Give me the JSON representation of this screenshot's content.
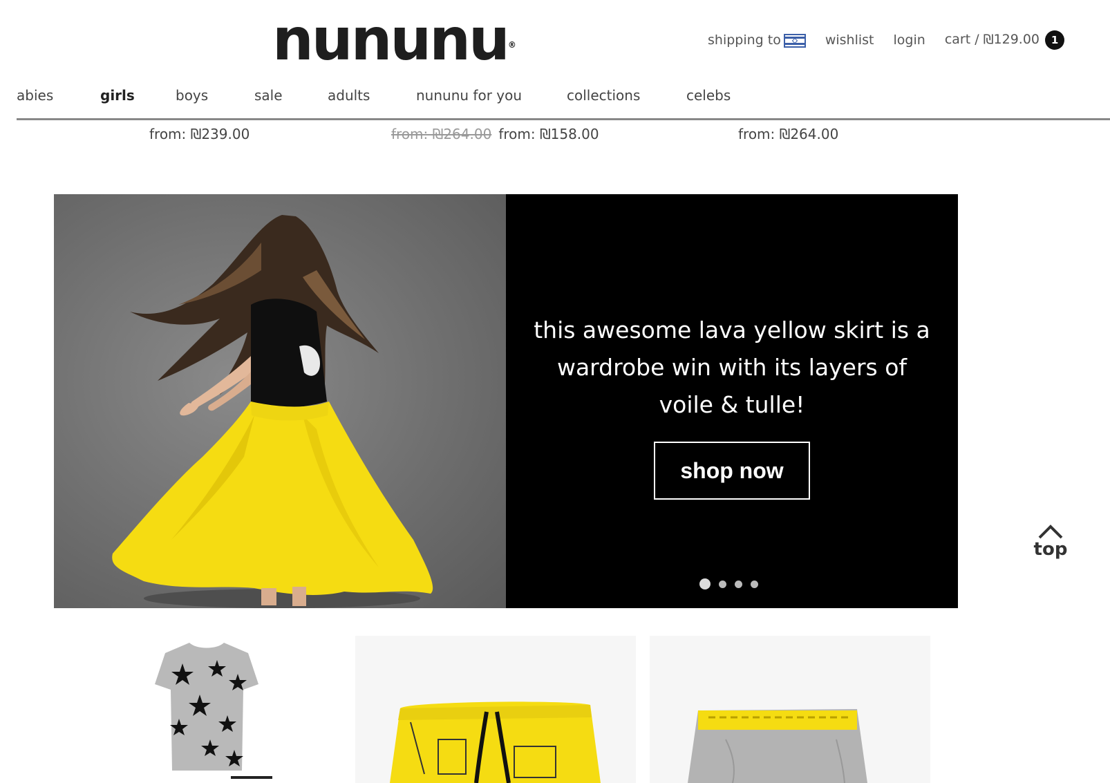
{
  "brand": {
    "logo": "nununu",
    "registered": "®"
  },
  "header": {
    "shipping_label": "shipping to",
    "shipping_flag": "flag-icon",
    "wishlist": "wishlist",
    "login": "login",
    "cart": "cart / ₪129.00",
    "cart_count": "1"
  },
  "nav": {
    "items": [
      "abies",
      "girls",
      "boys",
      "sale",
      "adults",
      "nununu for you",
      "collections",
      "celebs"
    ],
    "active": "girls"
  },
  "prices": {
    "p1": "from: ₪239.00",
    "p2_old": "from: ₪264.00",
    "p2": "from: ₪158.00",
    "p3": "from: ₪264.00"
  },
  "hero": {
    "text": "this awesome lava yellow skirt is a wardrobe win with its layers of voile & tulle!",
    "button": "shop now",
    "slide_count": 4,
    "active_slide": 1
  },
  "top_button": {
    "label": "top",
    "icon": "chevron-up-icon"
  },
  "colors": {
    "skirt_yellow": "#f5dc12",
    "hero_bg": "#000000",
    "text_dark": "#1e1e1e"
  }
}
